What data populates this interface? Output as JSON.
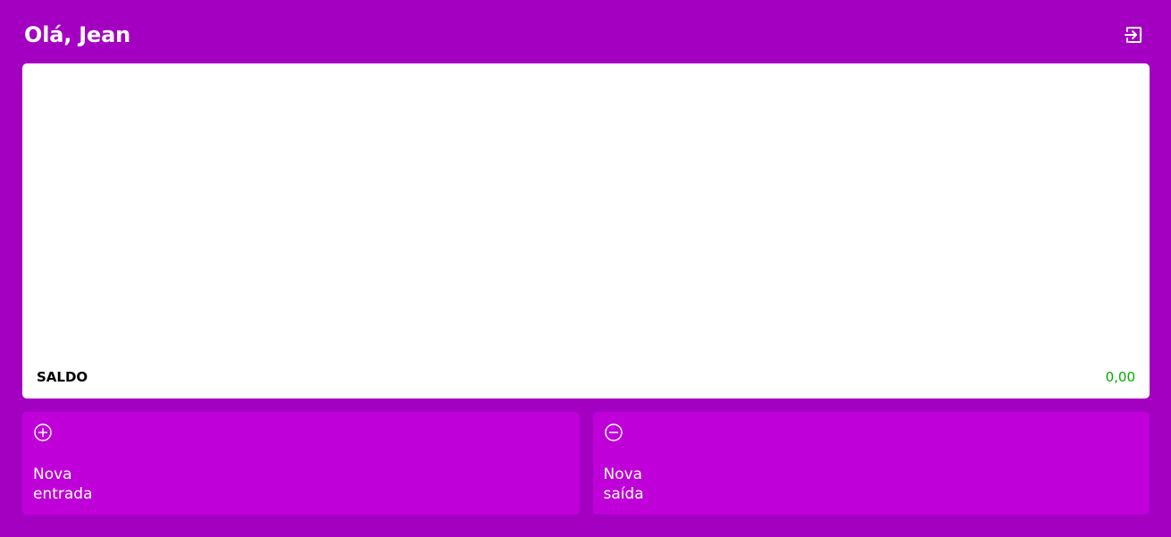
{
  "header": {
    "greeting": "Olá, Jean",
    "logout_icon": "logout-icon"
  },
  "records": {
    "saldo_label": "SALDO",
    "saldo_value": "0,00"
  },
  "actions": {
    "new_entry": {
      "line1": "Nova",
      "line2": "entrada",
      "icon": "plus-circle-icon"
    },
    "new_exit": {
      "line1": "Nova",
      "line2": "saída",
      "icon": "minus-circle-icon"
    }
  },
  "colors": {
    "background": "#a400c1",
    "button": "#bf00d9",
    "positive_balance": "#03ac00"
  }
}
